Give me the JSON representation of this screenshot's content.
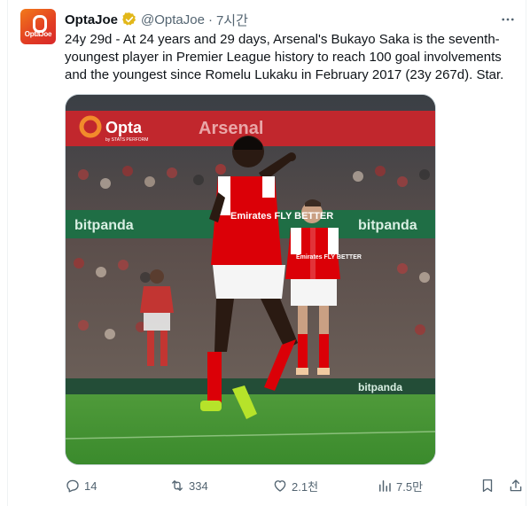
{
  "tweet": {
    "display_name": "OptaJoe",
    "handle": "@OptaJoe",
    "separator": "·",
    "timestamp": "7시간",
    "avatar_text": "OptaJoe",
    "text": "24y 29d - At 24 years and 29 days, Arsenal's Bukayo Saka is the seventh-youngest player in Premier League history to reach 100 goal involvements and the youngest since Romelu Lukaku in February 2017 (23y 267d). Star.",
    "media": {
      "watermark_brand": "Opta",
      "watermark_sub": "by STATS PERFORM",
      "board_text_top": "Arsenal",
      "board_text_bottom": "bitpanda",
      "player1_sponsor": "Emirates FLY BETTER",
      "player2_sponsor": "Emirates FLY BETTER"
    },
    "actions": {
      "replies": "14",
      "retweets": "334",
      "likes": "2.1천",
      "views": "7.5만"
    },
    "icons": {
      "verified": "verified-badge-icon",
      "more": "more-icon",
      "reply": "reply-icon",
      "retweet": "retweet-icon",
      "like": "heart-icon",
      "views": "views-chart-icon",
      "bookmark": "bookmark-icon",
      "share": "share-icon"
    },
    "colors": {
      "verified_gold": "#e2b719",
      "arsenal_red": "#db0007",
      "grass": "#3d8a2e",
      "text_muted": "#536471"
    }
  }
}
